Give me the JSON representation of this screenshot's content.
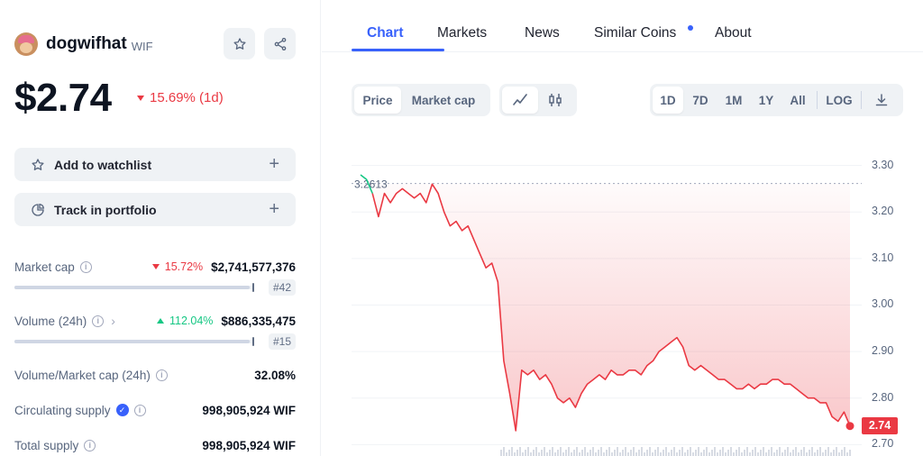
{
  "coin": {
    "name": "dogwifhat",
    "symbol": "WIF",
    "price": "$2.74",
    "change_1d": "15.69% (1d)",
    "change_direction": "down"
  },
  "header_icons": [
    "star-icon",
    "share-icon"
  ],
  "actions": {
    "watchlist": "Add to watchlist",
    "portfolio": "Track in portfolio"
  },
  "stats": {
    "market_cap": {
      "label": "Market cap",
      "change": "15.72%",
      "value": "$2,741,577,376",
      "rank": "#42",
      "bar_fill_pct": 98
    },
    "volume": {
      "label": "Volume (24h)",
      "change": "112.04%",
      "value": "$886,335,475",
      "rank": "#15",
      "bar_fill_pct": 98
    },
    "vol_mcap": {
      "label": "Volume/Market cap (24h)",
      "value": "32.08%"
    },
    "circulating": {
      "label": "Circulating supply",
      "value": "998,905,924 WIF"
    },
    "total": {
      "label": "Total supply",
      "value": "998,905,924 WIF"
    }
  },
  "tabs": [
    "Chart",
    "Markets",
    "News",
    "Similar Coins",
    "About"
  ],
  "active_tab": "Chart",
  "chart_controls": {
    "metric": [
      "Price",
      "Market cap"
    ],
    "metric_selected": "Price",
    "chart_styles": [
      "line-chart-icon",
      "candlestick-icon"
    ],
    "ranges": [
      "1D",
      "7D",
      "1M",
      "1Y",
      "All"
    ],
    "range_selected": "1D",
    "log_label": "LOG",
    "download_icon": "download-icon"
  },
  "colors": {
    "accent": "#3861fb",
    "down": "#ea3943",
    "up": "#16c784"
  },
  "chart_data": {
    "type": "line",
    "open_price_label": "3.2613",
    "open_price": 3.2613,
    "last_price_label": "2.74",
    "y_ticks": [
      "3.30",
      "3.20",
      "3.10",
      "3.00",
      "2.90",
      "2.80",
      "2.70"
    ],
    "ylim": [
      2.6755,
      3.3516
    ],
    "grid": true,
    "series": [
      {
        "values": [
          3.28,
          3.27,
          3.24,
          3.19,
          3.24,
          3.22,
          3.24,
          3.25,
          3.24,
          3.23,
          3.24,
          3.22,
          3.26,
          3.24,
          3.2,
          3.17,
          3.18,
          3.16,
          3.17,
          3.14,
          3.11,
          3.08,
          3.09,
          3.05,
          2.88,
          2.81,
          2.73,
          2.86,
          2.85,
          2.86,
          2.84,
          2.85,
          2.83,
          2.8,
          2.79,
          2.8,
          2.78,
          2.81,
          2.83,
          2.84,
          2.85,
          2.84,
          2.86,
          2.85,
          2.85,
          2.86,
          2.86,
          2.85,
          2.87,
          2.88,
          2.9,
          2.91,
          2.92,
          2.93,
          2.91,
          2.87,
          2.86,
          2.87,
          2.86,
          2.85,
          2.84,
          2.84,
          2.83,
          2.82,
          2.82,
          2.83,
          2.82,
          2.83,
          2.83,
          2.84,
          2.84,
          2.83,
          2.83,
          2.82,
          2.81,
          2.8,
          2.8,
          2.79,
          2.79,
          2.76,
          2.75,
          2.77,
          2.74
        ]
      }
    ]
  }
}
